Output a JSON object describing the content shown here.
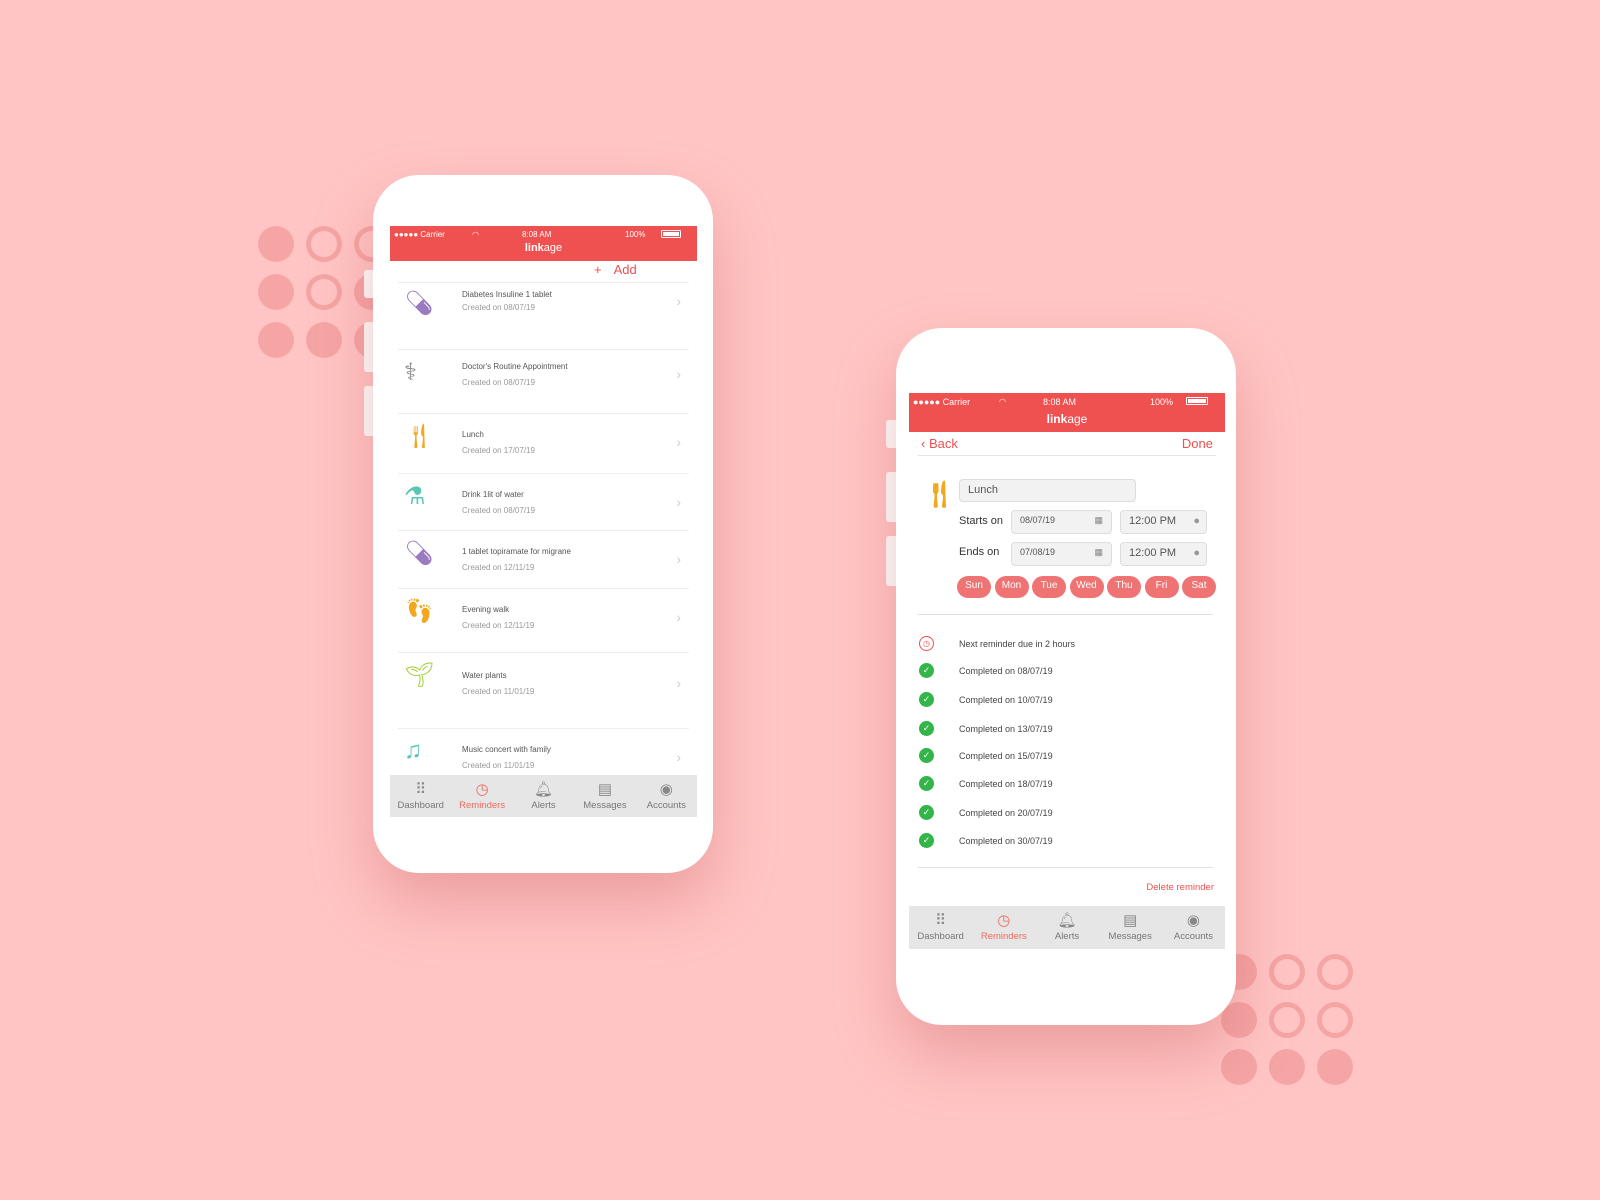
{
  "app": {
    "title_bold": "link",
    "title_rest": "age"
  },
  "status_bar": {
    "carrier": "●●●●● Carrier",
    "time": "8:08 AM",
    "battery": "100%"
  },
  "colors": {
    "accent": "#ef5050",
    "background": "#ffc5c4",
    "check": "#33b54a",
    "day_pill": "#ef7373"
  },
  "list_screen": {
    "add_label": "Add",
    "add_icon": "plus-icon",
    "items": [
      {
        "title": "Diabetes Insuline 1 tablet",
        "created": "Created on 08/07/19",
        "icon": "pill-icon"
      },
      {
        "title": "Doctor's Routine Appointment",
        "created": "Created on 08/07/19",
        "icon": "stethoscope-icon"
      },
      {
        "title": "Lunch",
        "created": "Created on 17/07/19",
        "icon": "fork-knife-icon"
      },
      {
        "title": "Drink 1lit of water",
        "created": "Created on 08/07/19",
        "icon": "flask-icon"
      },
      {
        "title": "1 tablet topiramate for migrane",
        "created": "Created on 12/11/19",
        "icon": "pill-icon"
      },
      {
        "title": "Evening walk",
        "created": "Created on 12/11/19",
        "icon": "footprints-icon"
      },
      {
        "title": "Water plants",
        "created": "Created on 11/01/19",
        "icon": "plant-icon"
      },
      {
        "title": "Music concert with family",
        "created": "Created on 11/01/19",
        "icon": "music-note-icon"
      }
    ]
  },
  "tabs": [
    {
      "label": "Dashboard",
      "icon": "dashboard-icon"
    },
    {
      "label": "Reminders",
      "icon": "clock-icon",
      "active": true
    },
    {
      "label": "Alerts",
      "icon": "bell-icon"
    },
    {
      "label": "Messages",
      "icon": "message-icon"
    },
    {
      "label": "Accounts",
      "icon": "user-icon"
    }
  ],
  "detail_screen": {
    "back_label": "Back",
    "done_label": "Done",
    "name_value": "Lunch",
    "starts_label": "Starts on",
    "start_date": "08/07/19",
    "start_time": "12:00 PM",
    "ends_label": "Ends on",
    "end_date": "07/08/19",
    "end_time": "12:00 PM",
    "days": [
      "Sun",
      "Mon",
      "Tue",
      "Wed",
      "Thu",
      "Fri",
      "Sat"
    ],
    "next_reminder": "Next reminder due in 2 hours",
    "history": [
      "Completed on 08/07/19",
      "Completed on 10/07/19",
      "Completed on 13/07/19",
      "Completed on 15/07/19",
      "Completed on 18/07/19",
      "Completed on 20/07/19",
      "Completed on 30/07/19"
    ],
    "delete_label": "Delete reminder"
  }
}
